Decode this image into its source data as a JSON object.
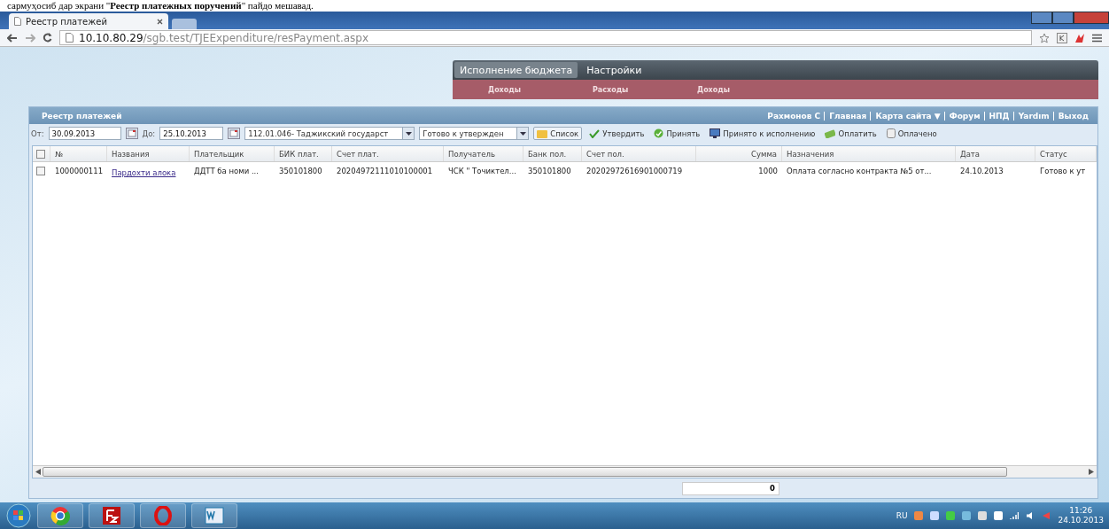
{
  "document_caption": "сармуҳосиб дар экрани \"**Реестр платежных поручений**\" пайдо мешавад.",
  "browser": {
    "tab_title": "Реестр платежей",
    "address_host": "10.10.80.29",
    "address_path": "/sgb.test/TJEExpenditure/resPayment.aspx"
  },
  "menu": {
    "items": [
      {
        "label": "Исполнение бюджета",
        "selected": true
      },
      {
        "label": "Настройки",
        "selected": false
      }
    ],
    "submenu": [
      "Доходы",
      "Расходы",
      "Доходы"
    ]
  },
  "panel": {
    "title": "Реестр платежей",
    "user_links": [
      "Рахмонов С",
      "Главная",
      "Карта сайта ▼",
      "Форум",
      "НПД",
      "Yardım",
      "Выход"
    ],
    "filters": {
      "from_label": "От:",
      "from": "30.09.2013",
      "to_label": "До:",
      "to": "25.10.2013",
      "organization": "112.01.046- Таджикский государст",
      "status": "Готово к утвержден"
    },
    "actions": [
      {
        "kind": "list",
        "label": "Список"
      },
      {
        "kind": "approve",
        "label": "Утвердить"
      },
      {
        "kind": "accept",
        "label": "Принять"
      },
      {
        "kind": "execute",
        "label": "Принято к исполнению"
      },
      {
        "kind": "pay",
        "label": "Оплатить"
      },
      {
        "kind": "paid",
        "label": "Оплачено"
      }
    ],
    "table": {
      "select_all_checked": false,
      "columns": [
        "№",
        "Названия",
        "Плательщик",
        "БИК плат.",
        "Счет плат.",
        "Получатель",
        "Банк пол.",
        "Счет пол.",
        "Сумма",
        "Назначения",
        "Дата",
        "Статус"
      ],
      "rows": [
        {
          "checked": false,
          "cells": [
            "1000000111",
            "Пардохти алока",
            "ДДТТ ба номи ...",
            "350101800",
            "20204972111010100001",
            "ЧСК \" Точиктел...",
            "350101800",
            "20202972616901000719",
            "1000",
            "Оплата согласно контракта №5 от...",
            "24.10.2013",
            "Готово к ут"
          ]
        }
      ]
    },
    "total": "0"
  },
  "taskbar": {
    "language": "RU",
    "time": "11:26",
    "date": "24.10.2013"
  }
}
